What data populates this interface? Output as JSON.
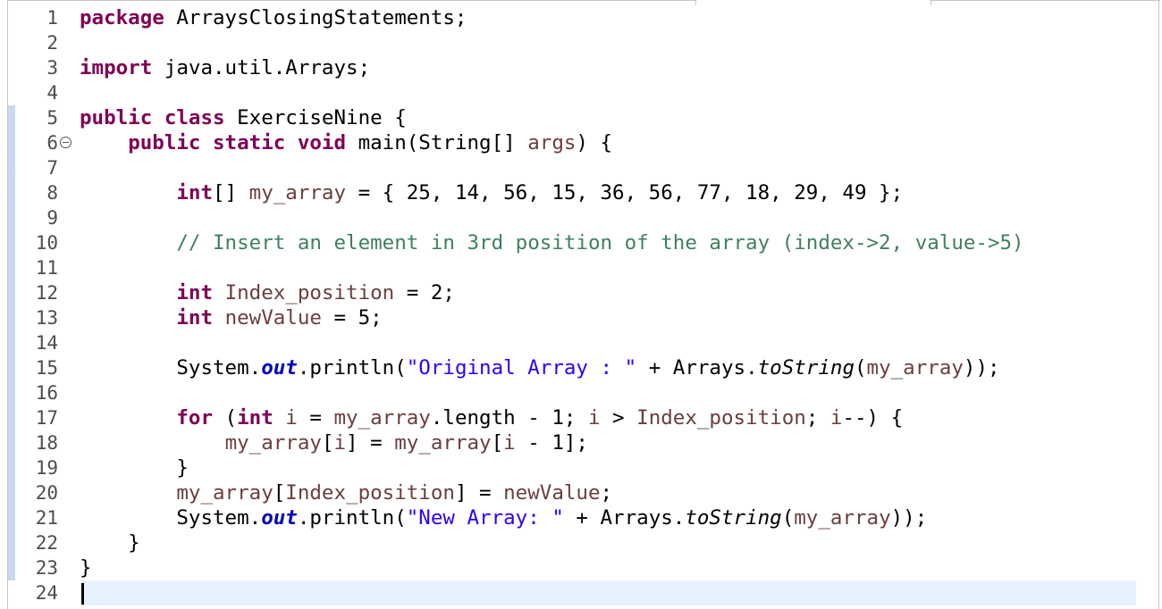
{
  "editor": {
    "lines": [
      {
        "n": "1"
      },
      {
        "n": "2"
      },
      {
        "n": "3"
      },
      {
        "n": "4"
      },
      {
        "n": "5"
      },
      {
        "n": "6"
      },
      {
        "n": "7"
      },
      {
        "n": "8"
      },
      {
        "n": "9"
      },
      {
        "n": "10"
      },
      {
        "n": "11"
      },
      {
        "n": "12"
      },
      {
        "n": "13"
      },
      {
        "n": "14"
      },
      {
        "n": "15"
      },
      {
        "n": "16"
      },
      {
        "n": "17"
      },
      {
        "n": "18"
      },
      {
        "n": "19"
      },
      {
        "n": "20"
      },
      {
        "n": "21"
      },
      {
        "n": "22"
      },
      {
        "n": "23"
      },
      {
        "n": "24"
      }
    ],
    "tokens": {
      "l1": [
        "package",
        " ArraysClosingStatements;"
      ],
      "l3": [
        "import",
        " java.util.Arrays;"
      ],
      "l5": [
        "public",
        " ",
        "class",
        " ExerciseNine {"
      ],
      "l6": [
        "    ",
        "public",
        " ",
        "static",
        " ",
        "void",
        " main(String[] ",
        "args",
        ") {"
      ],
      "l8": [
        "        ",
        "int",
        "[] ",
        "my_array",
        " = { 25, 14, 56, 15, 36, 56, 77, 18, 29, 49 };"
      ],
      "l10": [
        "        ",
        "// Insert an element in 3rd position of the array (index->2, value->5)"
      ],
      "l12": [
        "        ",
        "int",
        " ",
        "Index_position",
        " = 2;"
      ],
      "l13": [
        "        ",
        "int",
        " ",
        "newValue",
        " = 5;"
      ],
      "l15": [
        "        System.",
        "out",
        ".println(",
        "\"Original Array : \"",
        " + Arrays.",
        "toString",
        "(",
        "my_array",
        "));"
      ],
      "l17": [
        "        ",
        "for",
        " (",
        "int",
        " ",
        "i",
        " = ",
        "my_array",
        ".length - 1; ",
        "i",
        " > ",
        "Index_position",
        "; ",
        "i",
        "--) {"
      ],
      "l18": [
        "            ",
        "my_array",
        "[",
        "i",
        "] = ",
        "my_array",
        "[",
        "i",
        " - 1];"
      ],
      "l19": [
        "        }"
      ],
      "l20": [
        "        ",
        "my_array",
        "[",
        "Index_position",
        "] = ",
        "newValue",
        ";"
      ],
      "l21": [
        "        System.",
        "out",
        ".println(",
        "\"New Array: \"",
        " + Arrays.",
        "toString",
        "(",
        "my_array",
        "));"
      ],
      "l22": [
        "    }"
      ],
      "l23": [
        "}"
      ]
    }
  }
}
